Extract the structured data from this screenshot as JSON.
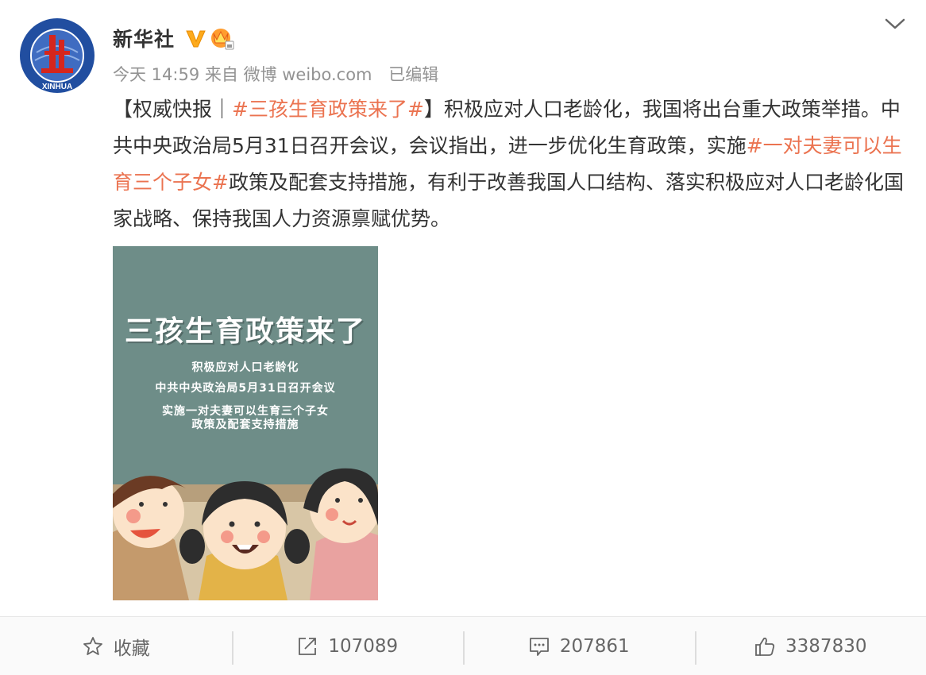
{
  "colors": {
    "accent": "#eb7350",
    "text": "#333333",
    "meta": "#939393",
    "vip": "#fdaa1c",
    "logo": "#214ea0"
  },
  "post": {
    "author": "新华社",
    "logo_text": "XINHUA",
    "verified_icon": "verified-v-icon",
    "member_icon": "crown-icon",
    "meta": {
      "time": "今天 14:59",
      "source": "来自 微博 weibo.com",
      "edited": "已编辑"
    },
    "text": {
      "p1": "【权威快报｜",
      "tag1": "#三孩生育政策来了#",
      "p2": "】积极应对人口老龄化，我国将出台重大政策举措。中共中央政治局5月31日召开会议，会议指出，进一步优化生育政策，实施",
      "tag2": "#一对夫妻可以生育三个子女#",
      "p3": "政策及配套支持措施，有利于改善我国人口结构、落实积极应对人口老龄化国家战略、保持我国人力资源禀赋优势。"
    },
    "image": {
      "title": "三孩生育政策来了",
      "lines": [
        "积极应对人口老龄化",
        "中共中央政治局5月31日召开会议",
        "实施一对夫妻可以生育三个子女",
        "政策及配套支持措施"
      ]
    }
  },
  "actions": {
    "favorite": {
      "label": "收藏",
      "icon": "star-icon"
    },
    "repost": {
      "count": "107089",
      "icon": "repost-icon"
    },
    "comment": {
      "count": "207861",
      "icon": "comment-icon"
    },
    "like": {
      "count": "3387830",
      "icon": "thumbs-up-icon"
    }
  }
}
